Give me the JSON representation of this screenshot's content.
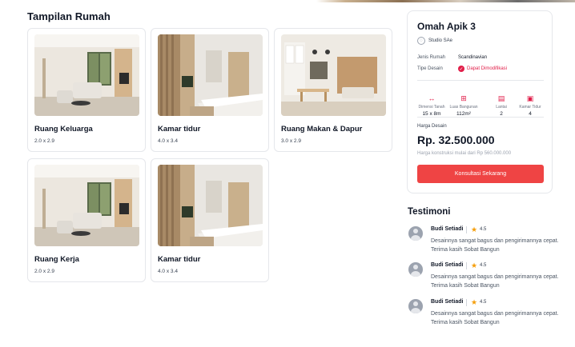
{
  "section_title": "Tampilan Rumah",
  "rooms": [
    {
      "name": "Ruang Keluarga",
      "size": "2.0 x 2.9",
      "scene": "living"
    },
    {
      "name": "Kamar tidur",
      "size": "4.0 x 3.4",
      "scene": "bedroom"
    },
    {
      "name": "Ruang Makan & Dapur",
      "size": "3.0 x 2.9",
      "scene": "dining"
    },
    {
      "name": "Ruang Kerja",
      "size": "2.0 x 2.9",
      "scene": "living"
    },
    {
      "name": "Kamar tidur",
      "size": "4.0 x 3.4",
      "scene": "bedroom"
    }
  ],
  "design": {
    "title": "Omah Apik 3",
    "studio": "Studio SAe",
    "house_type_label": "Jenis Rumah",
    "house_type_value": "Scandinavian",
    "design_type_label": "Tipe Desain",
    "design_type_value": "Dapat Dimodifikasi",
    "stats": [
      {
        "label": "Dimensi Tanah",
        "value": "15 x 8m",
        "icon": "ruler-arrows-icon"
      },
      {
        "label": "Luas Bangunan",
        "value": "112m²",
        "icon": "floor-area-icon"
      },
      {
        "label": "Lantai",
        "value": "2",
        "icon": "floors-icon"
      },
      {
        "label": "Kamar Tidur",
        "value": "4",
        "icon": "bed-icon"
      }
    ],
    "price_label": "Harga Desain",
    "price": "Rp. 32.500.000",
    "price_note": "Harga konstruksi mulai dari Rp 560.000.000",
    "cta_label": "Konsultasi Sekarang",
    "accent_color": "#ef4444"
  },
  "testimonials": {
    "title": "Testimoni",
    "items": [
      {
        "name": "Budi Setiadi",
        "rating": "4.5",
        "text": "Desainnya sangat bagus dan pengirimannya cepat. Terima kasih Sobat Bangun"
      },
      {
        "name": "Budi Setiadi",
        "rating": "4.5",
        "text": "Desainnya sangat bagus dan pengirimannya cepat. Terima kasih Sobat Bangun"
      },
      {
        "name": "Budi Setiadi",
        "rating": "4.5",
        "text": "Desainnya sangat bagus dan pengirimannya cepat. Terima kasih Sobat Bangun"
      }
    ]
  }
}
